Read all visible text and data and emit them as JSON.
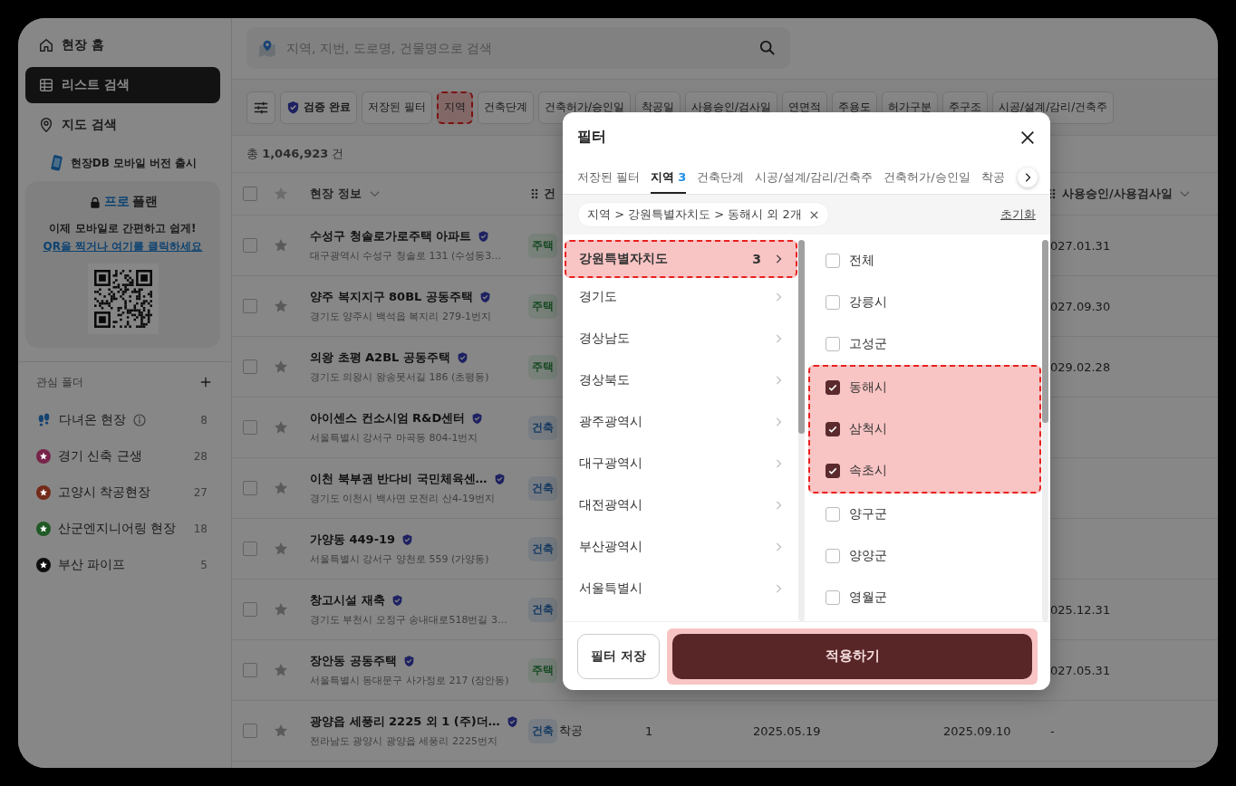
{
  "sidebar": {
    "nav": [
      {
        "kind": "home",
        "label": "현장 홈",
        "selected": false
      },
      {
        "kind": "list",
        "label": "리스트 검색",
        "selected": true
      },
      {
        "kind": "map",
        "label": "지도 검색",
        "selected": false
      }
    ],
    "notice": "현장DB 모바일 버전 출시",
    "promo": {
      "plan_name": "프로",
      "plan_label": "플랜",
      "text": "이제 모바일로 간편하고 쉽게!",
      "link": "QR을 찍거나 여기를 클릭하세요"
    },
    "folders_title": "관심 폴더",
    "folders": [
      {
        "kind": "history",
        "label": "다녀온 현장",
        "count": "8"
      },
      {
        "kind": "folder",
        "label": "경기 신축 근생",
        "count": "28",
        "color": "#772349"
      },
      {
        "kind": "folder",
        "label": "고양시 착공현장",
        "count": "27",
        "color": "#732a19"
      },
      {
        "kind": "folder",
        "label": "산군엔지니어링 현장",
        "count": "18",
        "color": "#1f5925"
      },
      {
        "kind": "folder",
        "label": "부산 파이프",
        "count": "5",
        "color": "#0e0e0e"
      }
    ]
  },
  "search": {
    "placeholder": "지역, 지번, 도로명, 건물명으로 검색"
  },
  "filter_chips": [
    {
      "kind": "settings"
    },
    {
      "kind": "verified",
      "label": "검증 완료",
      "highlighted": false
    },
    {
      "kind": "text",
      "label": "저장된 필터",
      "highlighted": false
    },
    {
      "kind": "text",
      "label": "지역",
      "highlighted": true
    },
    {
      "kind": "text",
      "label": "건축단계",
      "highlighted": false
    },
    {
      "kind": "text",
      "label": "건축허가/승인일",
      "highlighted": false
    },
    {
      "kind": "text",
      "label": "착공일",
      "highlighted": false
    },
    {
      "kind": "text",
      "label": "사용승인/검사일",
      "highlighted": false
    },
    {
      "kind": "text",
      "label": "연면적",
      "highlighted": false
    },
    {
      "kind": "text",
      "label": "주용도",
      "highlighted": false
    },
    {
      "kind": "text",
      "label": "허가구분",
      "highlighted": false
    },
    {
      "kind": "text",
      "label": "주구조",
      "highlighted": false
    },
    {
      "kind": "text",
      "label": "시공/설계/감리/건축주",
      "highlighted": false
    }
  ],
  "total": "총 **1,046,923** 건",
  "table": {
    "select_all_checked": false,
    "columns": [
      {
        "label": "현장 정보",
        "menu": true
      },
      {
        "label": "건",
        "menu": false
      },
      {
        "label": "사용승인/사용검사일",
        "menu": true
      }
    ],
    "rows": [
      {
        "checked": false,
        "title": "수성구 청솔로가로주택 아파트",
        "verified": true,
        "address": "대구광역시 수성구 청솔로 131 (수성동3…",
        "tag": {
          "text": "주택",
          "kind": "housing"
        },
        "approval_date": "027.01.31"
      },
      {
        "checked": false,
        "title": "양주 복지지구 80BL 공동주택",
        "verified": true,
        "address": "경기도 양주시 백석읍 복지리 279-1번지",
        "tag": {
          "text": "주택",
          "kind": "housing"
        },
        "approval_date": "027.09.30"
      },
      {
        "checked": false,
        "title": "의왕 초평 A2BL 공동주택",
        "verified": true,
        "address": "경기도 의왕시 왕송못서길 186 (초평동)",
        "tag": {
          "text": "주택",
          "kind": "housing"
        },
        "approval_date": "029.02.28"
      },
      {
        "checked": false,
        "title": "아이센스 컨소시엄 R&D센터",
        "verified": true,
        "address": "서울특별시 강서구 마곡동 804-1번지",
        "tag": {
          "text": "건축",
          "kind": "building"
        }
      },
      {
        "checked": false,
        "title": "이천 북부권 반다비 국민체육센…",
        "verified": true,
        "address": "경기도 이천시 백사면 모전리 산4-19번지",
        "tag": {
          "text": "건축",
          "kind": "building"
        }
      },
      {
        "checked": false,
        "title": "가양동 449-19",
        "verified": true,
        "address": "서울특별시 강서구 양천로 559 (가양동)",
        "tag": {
          "text": "건축",
          "kind": "building"
        }
      },
      {
        "checked": false,
        "title": "창고시설 재축",
        "verified": true,
        "address": "경기도 부천시 오정구 송내대로518번길 3…",
        "tag": {
          "text": "건축",
          "kind": "building"
        },
        "approval_date": "025.12.31"
      },
      {
        "checked": false,
        "title": "장안동 공동주택",
        "verified": true,
        "address": "서울특별시 동대문구 사가정로 217 (장안동)",
        "tag": {
          "text": "주택",
          "kind": "housing"
        },
        "approval_date": "027.05.31"
      },
      {
        "checked": false,
        "title": "광양읍 세풍리 2225 외 1 (주)더…",
        "verified": true,
        "address": "전라남도 광양시 광양읍 세풍리 2225번지",
        "tag": {
          "text": "건축",
          "kind": "building"
        },
        "column_5": "착공",
        "column_6": "1",
        "column_7": "2025.05.19",
        "column_8": "2025.09.10",
        "approval_date": "-"
      }
    ]
  },
  "modal": {
    "title": "필터",
    "tabs": [
      {
        "label": "저장된 필터",
        "selected": false
      },
      {
        "label": "지역",
        "count": "3",
        "selected": true
      },
      {
        "label": "건축단계",
        "selected": false
      },
      {
        "label": "시공/설계/감리/건축주",
        "selected": false
      },
      {
        "label": "건축허가/승인일",
        "selected": false
      },
      {
        "label": "착공",
        "selected": false
      }
    ],
    "breadcrumb": "지역 > 강원특별자치도 > 동해시 외 2개",
    "reset": "초기화",
    "regions": [
      {
        "label": "강원특별자치도",
        "count": "3",
        "selected": true,
        "highlighted": true
      },
      {
        "label": "경기도",
        "selected": false,
        "highlighted": false
      },
      {
        "label": "경상남도",
        "selected": false,
        "highlighted": false
      },
      {
        "label": "경상북도",
        "selected": false,
        "highlighted": false
      },
      {
        "label": "광주광역시",
        "selected": false,
        "highlighted": false
      },
      {
        "label": "대구광역시",
        "selected": false,
        "highlighted": false
      },
      {
        "label": "대전광역시",
        "selected": false,
        "highlighted": false
      },
      {
        "label": "부산광역시",
        "selected": false,
        "highlighted": false
      },
      {
        "label": "서울특별시",
        "selected": false,
        "highlighted": false
      }
    ],
    "options": [
      {
        "label": "전체",
        "checked": false,
        "highlighted": false
      },
      {
        "label": "강릉시",
        "checked": false,
        "highlighted": false
      },
      {
        "label": "고성군",
        "checked": false,
        "highlighted": false
      },
      {
        "label": "동해시",
        "checked": true,
        "highlighted": true
      },
      {
        "label": "삼척시",
        "checked": true,
        "highlighted": true
      },
      {
        "label": "속초시",
        "checked": true,
        "highlighted": true
      },
      {
        "label": "양구군",
        "checked": false,
        "highlighted": false
      },
      {
        "label": "양양군",
        "checked": false,
        "highlighted": false
      },
      {
        "label": "영월군",
        "checked": false,
        "highlighted": false
      }
    ],
    "save_button": "필터 저장",
    "apply_button": {
      "label": "적용하기",
      "highlighted": true
    }
  }
}
